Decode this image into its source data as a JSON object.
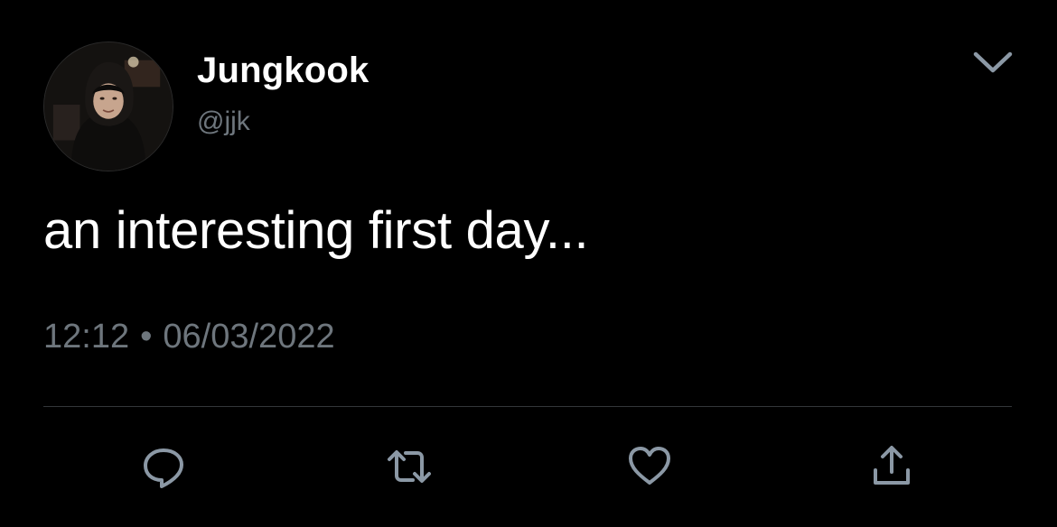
{
  "tweet": {
    "author": {
      "display_name": "Jungkook",
      "handle": "@jjk",
      "avatar_icon": "profile-photo"
    },
    "text": "an interesting first day...",
    "time": "12:12",
    "separator": "•",
    "date": "06/03/2022"
  },
  "actions": [
    {
      "icon": "reply-icon"
    },
    {
      "icon": "retweet-icon"
    },
    {
      "icon": "like-icon"
    },
    {
      "icon": "share-icon"
    }
  ],
  "colors": {
    "background": "#000000",
    "primary_text": "#ffffff",
    "secondary_text": "#6e767d",
    "divider": "#333639",
    "icon": "#8b98a5"
  }
}
